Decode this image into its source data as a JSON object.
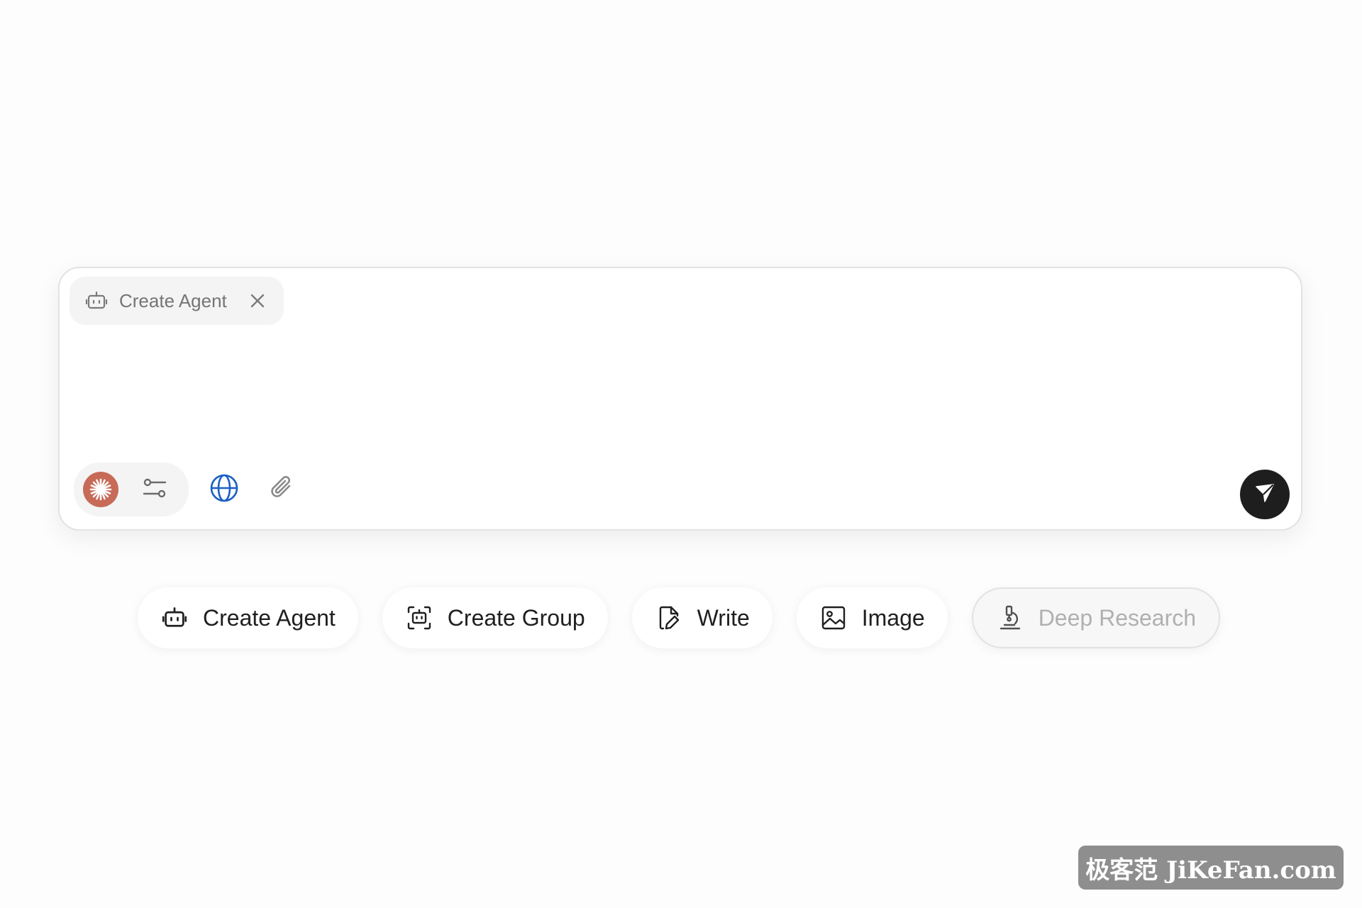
{
  "composer": {
    "chip": {
      "label": "Create Agent",
      "icon": "robot-icon",
      "close_icon": "close-icon"
    },
    "input": {
      "value": "",
      "placeholder": ""
    },
    "toolbar": {
      "model_icon": "claude-sparkle-icon",
      "model_color": "#c76a58",
      "settings_icon": "sliders-icon",
      "web_search_icon": "globe-icon",
      "web_search_color": "#1a5fc4",
      "attach_icon": "paperclip-icon"
    },
    "send_icon": "send-icon"
  },
  "quick_actions": [
    {
      "label": "Create Agent",
      "icon": "robot-icon",
      "enabled": true
    },
    {
      "label": "Create Group",
      "icon": "group-robot-icon",
      "enabled": true
    },
    {
      "label": "Write",
      "icon": "document-pen-icon",
      "enabled": true
    },
    {
      "label": "Image",
      "icon": "image-icon",
      "enabled": true
    },
    {
      "label": "Deep Research",
      "icon": "microscope-icon",
      "enabled": false
    }
  ],
  "watermark": {
    "text": "极客范 JiKeFan.com"
  }
}
